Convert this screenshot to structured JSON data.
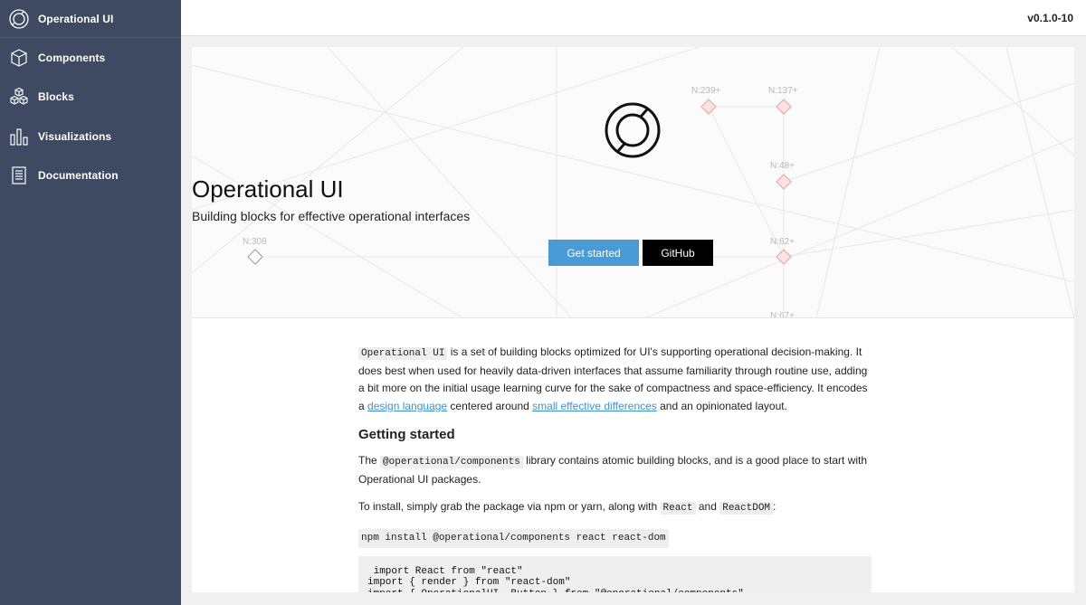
{
  "sidebar": {
    "brand": {
      "label": "Operational UI",
      "icon": "operational-logo-icon"
    },
    "items": [
      {
        "label": "Components",
        "icon": "cube-icon"
      },
      {
        "label": "Blocks",
        "icon": "blocks-icon"
      },
      {
        "label": "Visualizations",
        "icon": "bar-chart-icon"
      },
      {
        "label": "Documentation",
        "icon": "document-icon"
      }
    ]
  },
  "header": {
    "version": "v0.1.0-10"
  },
  "hero": {
    "title": "Operational UI",
    "subtitle": "Building blocks for effective operational interfaces",
    "primary_button": "Get started",
    "secondary_button": "GitHub",
    "node_labels": [
      "N:239+",
      "N:137+",
      "N:48+",
      "N:308",
      "N:62+",
      "N:67+"
    ]
  },
  "article": {
    "intro": {
      "code": "Operational UI",
      "text1": " is a set of building blocks optimized for UI's supporting operational decision-making. It does best when used for heavily data-driven interfaces that assume familiarity through routine use, adding a bit more on the initial usage learning curve for the sake of compactness and space-efficiency. It encodes a ",
      "link1": "design language",
      "text2": " centered around ",
      "link2": "small effective differences",
      "text3": " and an opinionated layout."
    },
    "getting_started_heading": "Getting started",
    "p2": {
      "text1": "The ",
      "code": "@operational/components",
      "text2": " library contains atomic building blocks, and is a good place to start with Operational UI packages."
    },
    "p3": {
      "text1": "To install, simply grab the package via npm or yarn, along with ",
      "code1": "React",
      "text2": " and ",
      "code2": "ReactDOM",
      "text3": ":"
    },
    "install_command": "npm install @operational/components react react-dom",
    "code_block": " import React from \"react\"\nimport { render } from \"react-dom\"\nimport { OperationalUI, Button } from \"@operational/components\""
  }
}
